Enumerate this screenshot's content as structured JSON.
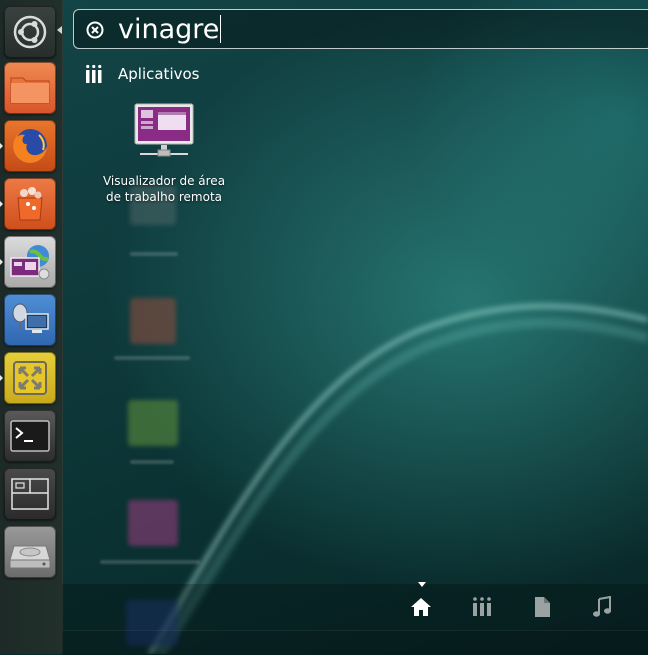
{
  "launcher": {
    "items": [
      {
        "name": "dash-home",
        "icon": "ubuntu-logo-icon"
      },
      {
        "name": "files",
        "icon": "folder-icon"
      },
      {
        "name": "firefox",
        "icon": "firefox-icon"
      },
      {
        "name": "software-center",
        "icon": "shopping-bag-icon"
      },
      {
        "name": "remote-desktop-viewer",
        "icon": "remote-desktop-icon"
      },
      {
        "name": "remote-desktop-client",
        "icon": "network-computer-icon"
      },
      {
        "name": "vmware",
        "icon": "vmware-icon"
      },
      {
        "name": "terminal",
        "icon": "terminal-icon"
      },
      {
        "name": "workspace-switcher",
        "icon": "workspaces-icon"
      },
      {
        "name": "disk",
        "icon": "hard-drive-icon"
      }
    ]
  },
  "search": {
    "query": "vinagre"
  },
  "category": {
    "label": "Aplicativos",
    "icon": "applications-lens-icon"
  },
  "results": [
    {
      "line1": "Visualizador de área",
      "line2": "de trabalho remota",
      "icon": "remote-desktop-viewer-icon"
    }
  ],
  "lenses": [
    {
      "name": "home",
      "icon": "home-icon",
      "active": true
    },
    {
      "name": "applications",
      "icon": "applications-lens-icon",
      "active": false
    },
    {
      "name": "files",
      "icon": "file-icon",
      "active": false
    },
    {
      "name": "music",
      "icon": "music-note-icon",
      "active": false
    }
  ],
  "colors": {
    "launcher_bg": "#22302c",
    "remote_viewer_purple": "#8a2b86",
    "firefox_orange": "#e66000"
  }
}
